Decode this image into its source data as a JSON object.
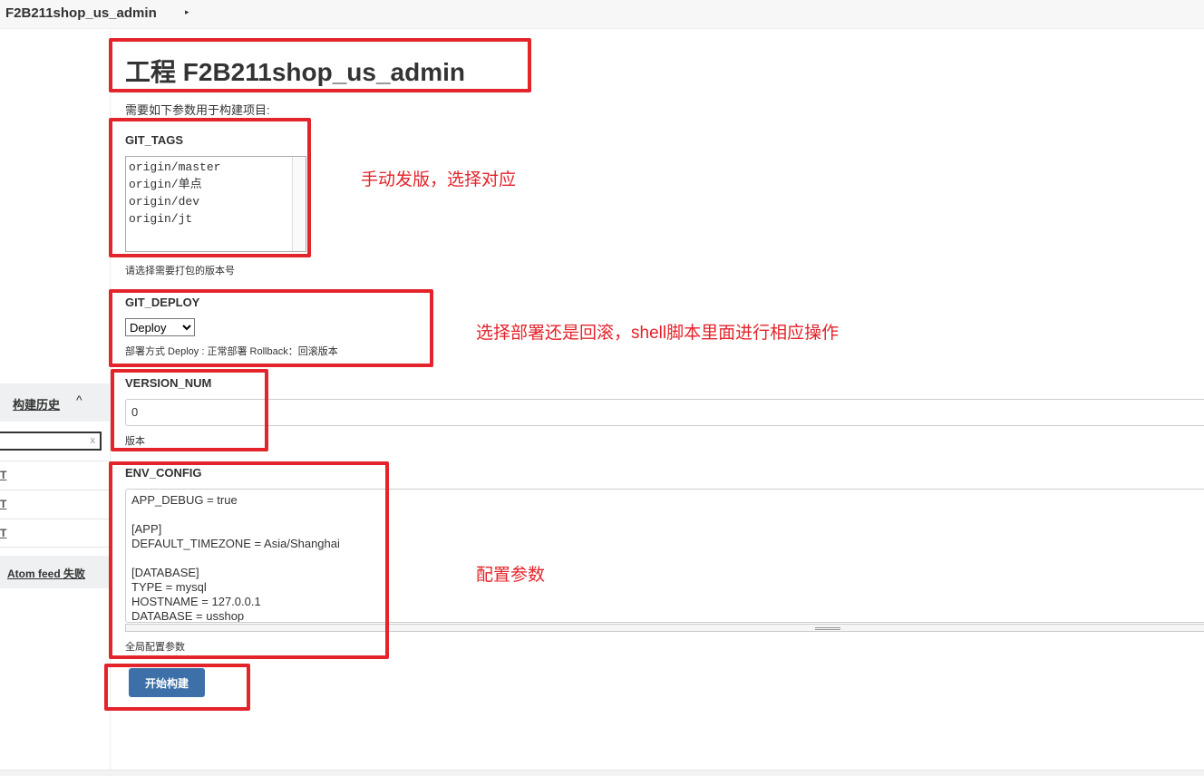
{
  "topbar": {
    "breadcrumb": "F2B211shop_us_admin",
    "arrow": "▸"
  },
  "sidebar": {
    "history_title": "构建历史",
    "collapse_icon": "^",
    "search_clear": "x",
    "rows": [
      "T",
      "T",
      "T"
    ],
    "atom_feed": "Atom feed 失败"
  },
  "main": {
    "title": "工程 F2B211shop_us_admin",
    "intro": "需要如下参数用于构建项目:",
    "git_tags": {
      "label": "GIT_TAGS",
      "options": [
        "origin/master",
        "origin/单点",
        "origin/dev",
        "origin/jt"
      ],
      "desc": "请选择需要打包的版本号"
    },
    "git_deploy": {
      "label": "GIT_DEPLOY",
      "selected": "Deploy",
      "desc": "部署方式 Deploy : 正常部署 Rollback：回滚版本"
    },
    "version_num": {
      "label": "VERSION_NUM",
      "value": "0",
      "desc": "版本"
    },
    "env_config": {
      "label": "ENV_CONFIG",
      "value": "APP_DEBUG = true\n\n[APP]\nDEFAULT_TIMEZONE = Asia/Shanghai\n\n[DATABASE]\nTYPE = mysql\nHOSTNAME = 127.0.0.1\nDATABASE = usshop",
      "desc": "全局配置参数"
    },
    "build_button": "开始构建"
  },
  "annotations": {
    "tags_note": "手动发版，选择对应",
    "deploy_note": "选择部署还是回滚，shell脚本里面进行相应操作",
    "env_note": "配置参数",
    "color": "#e3242b"
  }
}
